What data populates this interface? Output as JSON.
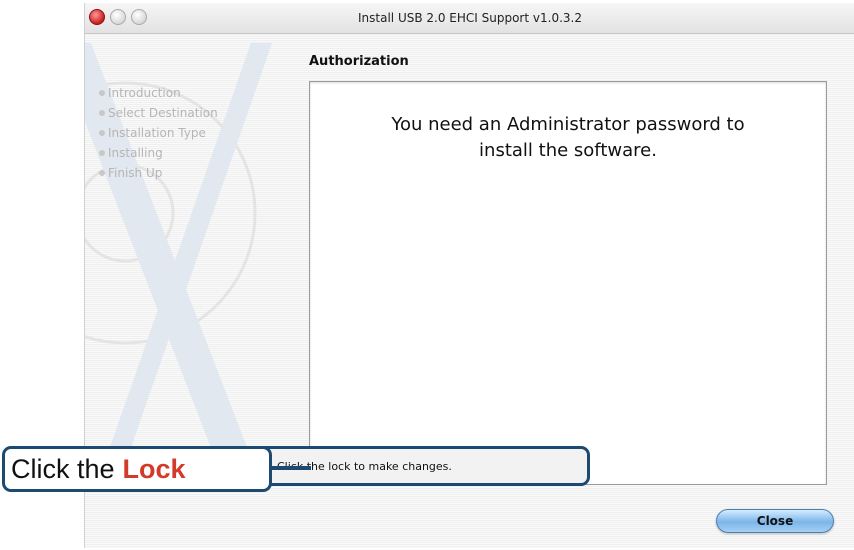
{
  "window": {
    "title": "Install USB 2.0 EHCI Support v1.0.3.2"
  },
  "steps": [
    "Introduction",
    "Select Destination",
    "Installation Type",
    "Installing",
    "Finish Up"
  ],
  "page": {
    "title": "Authorization"
  },
  "panel": {
    "message_line1": "You need an Administrator password to",
    "message_line2": "install the software."
  },
  "lock": {
    "text": "Click the lock to make changes."
  },
  "buttons": {
    "close_label": "Close"
  },
  "callout": {
    "prefix": "Click the",
    "strong": "Lock"
  },
  "colors": {
    "accent": "#d43a2a",
    "border": "#1c4a70",
    "button": "#7ab6ea"
  }
}
